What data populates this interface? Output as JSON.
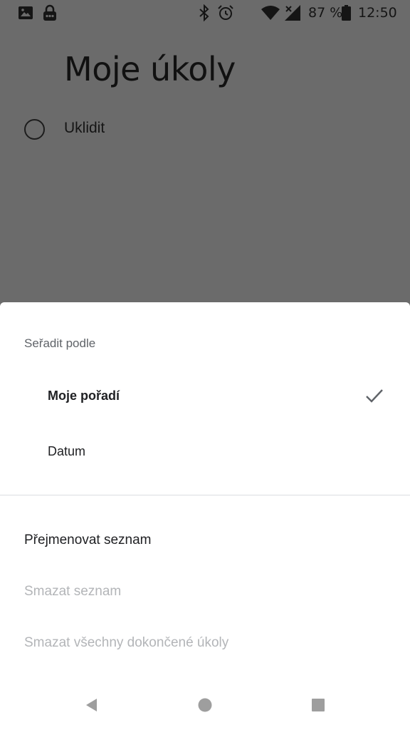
{
  "status_bar": {
    "battery_percent": "87 %",
    "time": "12:50",
    "icons": [
      "image-icon",
      "lock-icon",
      "bluetooth-icon",
      "alarm-icon",
      "wifi-icon",
      "signal-icon",
      "battery-icon"
    ]
  },
  "list": {
    "title": "Moje úkoly",
    "tasks": [
      {
        "label": "Uklidit",
        "completed": false
      }
    ]
  },
  "sheet": {
    "sort_heading": "Seřadit podle",
    "sort_options": [
      {
        "label": "Moje pořadí",
        "selected": true
      },
      {
        "label": "Datum",
        "selected": false
      }
    ],
    "actions": [
      {
        "label": "Přejmenovat seznam",
        "enabled": true
      },
      {
        "label": "Smazat seznam",
        "enabled": false
      },
      {
        "label": "Smazat všechny dokončené úkoly",
        "enabled": false
      }
    ]
  },
  "nav_bar": {
    "icons": [
      "back-icon",
      "home-icon",
      "recents-icon"
    ]
  },
  "colors": {
    "scrim": "#6b6b6b",
    "sheet_background": "#ffffff",
    "text_primary": "#202124",
    "text_secondary": "#5f6368",
    "text_disabled": "#b3b5b8",
    "divider": "#dadce0",
    "nav_icon": "#9e9e9e"
  }
}
